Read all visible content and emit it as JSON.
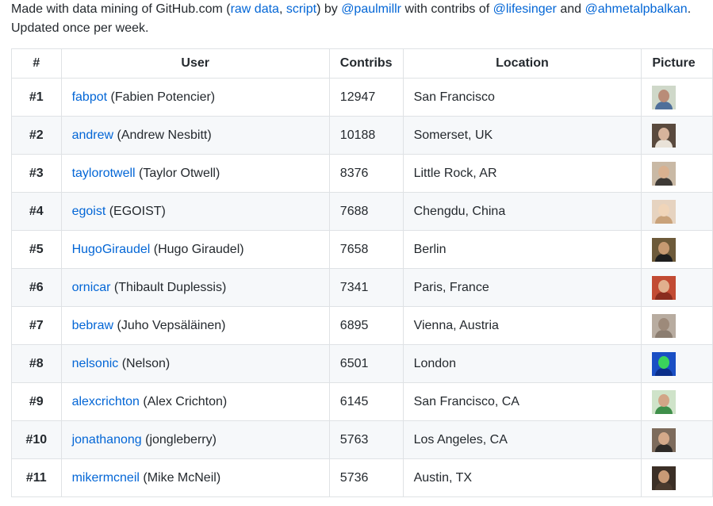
{
  "intro": {
    "made_with": "Made with data mining of GitHub.com (",
    "raw_data": "raw data",
    "comma": ", ",
    "script": "script",
    "by": ") by ",
    "author": "@paulmillr",
    "contribs_of": " with contribs of ",
    "contrib1": "@lifesinger",
    "and": " and ",
    "contrib2": "@ahmetalpbalkan",
    "period": ".",
    "updated": "Updated once per week."
  },
  "table": {
    "headers": {
      "rank": "#",
      "user": "User",
      "contribs": "Contribs",
      "location": "Location",
      "picture": "Picture"
    },
    "rows": [
      {
        "rank": "#1",
        "login": "fabpot",
        "name": " (Fabien Potencier)",
        "contribs": "12947",
        "location": "San Francisco",
        "avatar_bg": "#cfd8c9",
        "avatar_face": "#b98c78",
        "avatar_body": "#4e6f9a"
      },
      {
        "rank": "#2",
        "login": "andrew",
        "name": " (Andrew Nesbitt)",
        "contribs": "10188",
        "location": "Somerset, UK",
        "avatar_bg": "#5a4a3e",
        "avatar_face": "#d7b49c",
        "avatar_body": "#e9e2d8"
      },
      {
        "rank": "#3",
        "login": "taylorotwell",
        "name": " (Taylor Otwell)",
        "contribs": "8376",
        "location": "Little Rock, AR",
        "avatar_bg": "#c9b9a5",
        "avatar_face": "#d9b190",
        "avatar_body": "#3e3a36"
      },
      {
        "rank": "#4",
        "login": "egoist",
        "name": " (EGOIST)",
        "contribs": "7688",
        "location": "Chengdu, China",
        "avatar_bg": "#e6d3c0",
        "avatar_face": "#f0d5b9",
        "avatar_body": "#c9a27a"
      },
      {
        "rank": "#5",
        "login": "HugoGiraudel",
        "name": " (Hugo Giraudel)",
        "contribs": "7658",
        "location": "Berlin",
        "avatar_bg": "#6d5a3a",
        "avatar_face": "#c79a72",
        "avatar_body": "#1e1e1e"
      },
      {
        "rank": "#6",
        "login": "ornicar",
        "name": " (Thibault Duplessis)",
        "contribs": "7341",
        "location": "Paris, France",
        "avatar_bg": "#c24b33",
        "avatar_face": "#e1b08e",
        "avatar_body": "#8a2c1e"
      },
      {
        "rank": "#7",
        "login": "bebraw",
        "name": " (Juho Vepsäläinen)",
        "contribs": "6895",
        "location": "Vienna, Austria",
        "avatar_bg": "#b8aca0",
        "avatar_face": "#9d8a7a",
        "avatar_body": "#8b7d70"
      },
      {
        "rank": "#8",
        "login": "nelsonic",
        "name": " (Nelson)",
        "contribs": "6501",
        "location": "London",
        "avatar_bg": "#1a4fc4",
        "avatar_face": "#3ad35b",
        "avatar_body": "#0b2f8a"
      },
      {
        "rank": "#9",
        "login": "alexcrichton",
        "name": " (Alex Crichton)",
        "contribs": "6145",
        "location": "San Francisco, CA",
        "avatar_bg": "#cfe3c9",
        "avatar_face": "#d2a587",
        "avatar_body": "#3f8f4a"
      },
      {
        "rank": "#10",
        "login": "jonathanong",
        "name": " (jongleberry)",
        "contribs": "5763",
        "location": "Los Angeles, CA",
        "avatar_bg": "#7d6b5c",
        "avatar_face": "#d4a98a",
        "avatar_body": "#2e2a27"
      },
      {
        "rank": "#11",
        "login": "mikermcneil",
        "name": " (Mike McNeil)",
        "contribs": "5736",
        "location": "Austin, TX",
        "avatar_bg": "#3b2f26",
        "avatar_face": "#c89a76",
        "avatar_body": "#4a3a2e"
      }
    ]
  },
  "colors": {
    "link": "#0366d6",
    "border": "#dfe2e5",
    "stripe": "#f6f8fa",
    "text": "#24292e"
  }
}
